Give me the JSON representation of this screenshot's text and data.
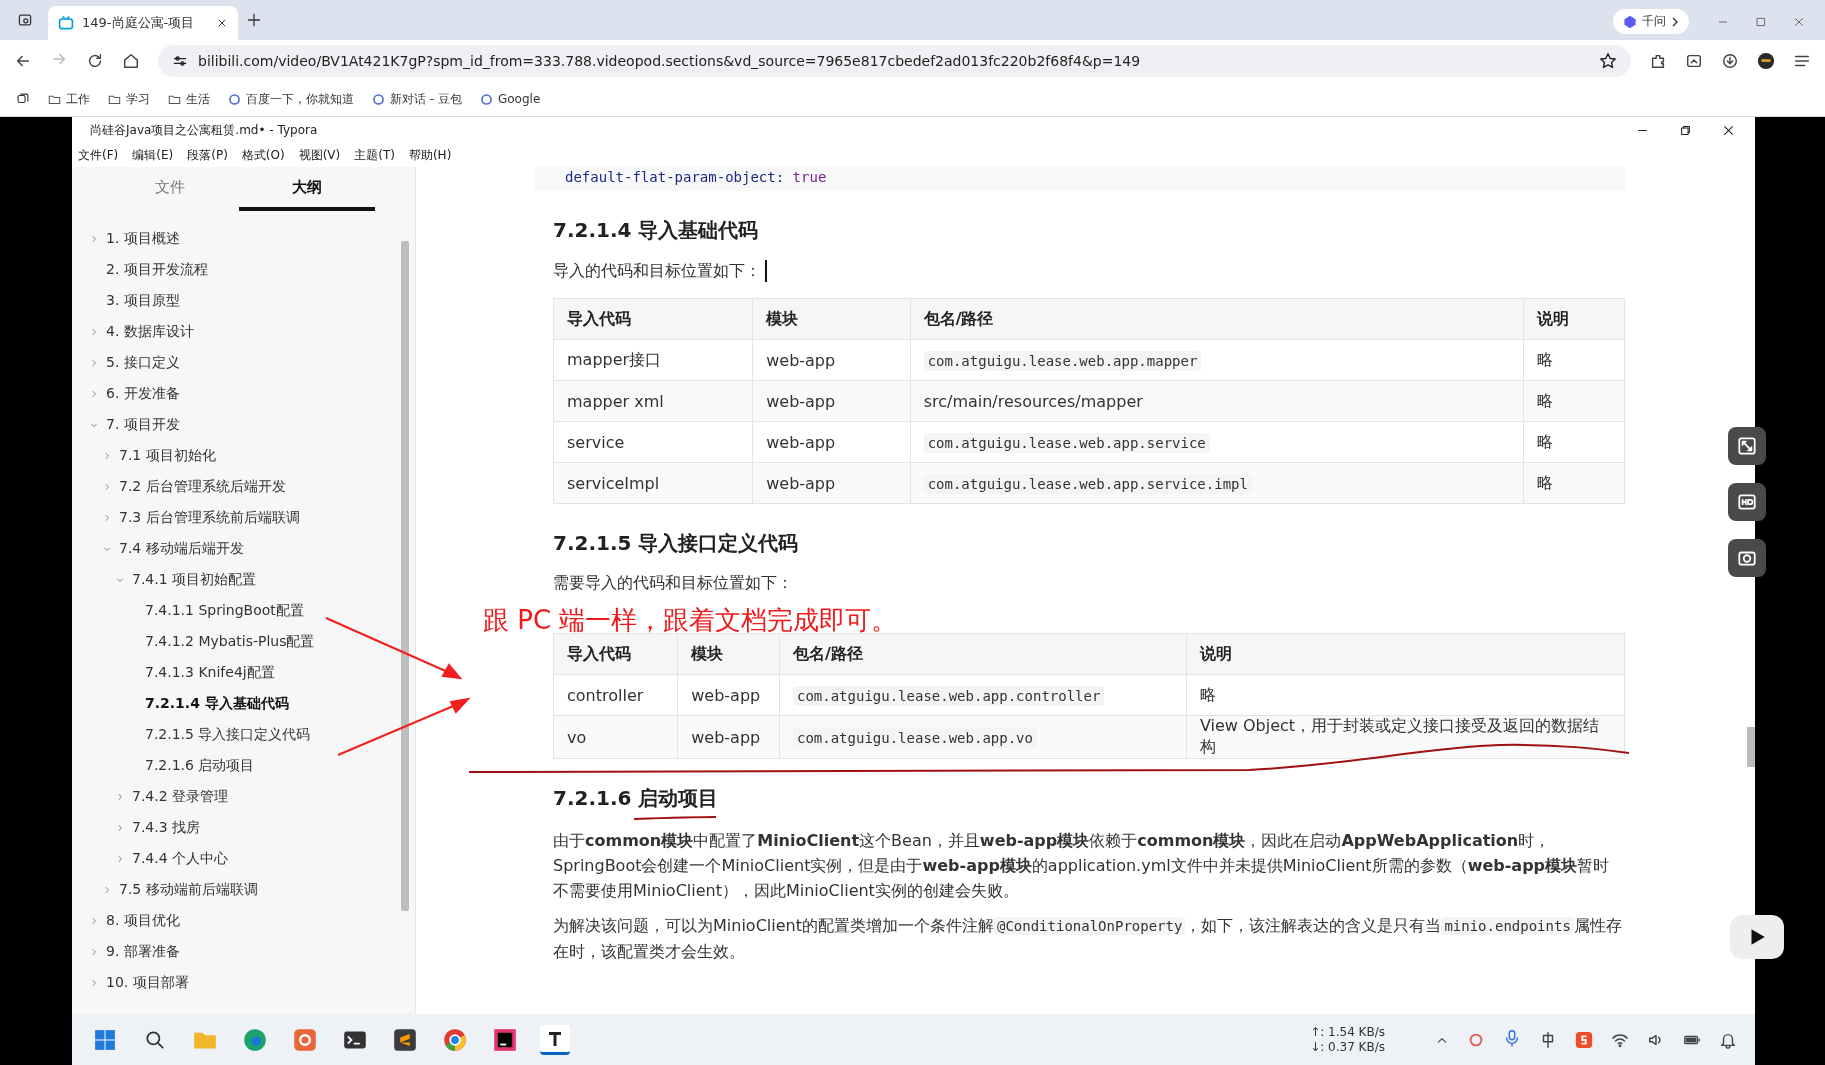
{
  "browser": {
    "tab": {
      "title": "149-尚庭公寓-项目",
      "selected": true
    },
    "assistant_button": "千问",
    "url": "bilibili.com/video/BV1At421K7gP?spm_id_from=333.788.videopod.sections&vd_source=7965e817cbedef2ad013fc220b2f68f4&p=149",
    "bookmarks": [
      {
        "label": "工作",
        "kind": "folder"
      },
      {
        "label": "学习",
        "kind": "folder"
      },
      {
        "label": "生活",
        "kind": "folder"
      },
      {
        "label": "百度一下，你就知道",
        "kind": "site"
      },
      {
        "label": "新对话 - 豆包",
        "kind": "site"
      },
      {
        "label": "Google",
        "kind": "site"
      }
    ]
  },
  "typora": {
    "title": "尚硅谷Java项目之公寓租赁.md• - Typora",
    "menu": [
      "文件(F)",
      "编辑(E)",
      "段落(P)",
      "格式(O)",
      "视图(V)",
      "主题(T)",
      "帮助(H)"
    ],
    "sidebar_tabs": [
      {
        "label": "文件",
        "selected": false
      },
      {
        "label": "大纲",
        "selected": true
      }
    ],
    "outline": [
      {
        "label": "1. 项目概述",
        "kind": "branch",
        "expanded": false,
        "selected": false
      },
      {
        "label": "2. 项目开发流程",
        "kind": "leaf",
        "selected": false
      },
      {
        "label": "3. 项目原型",
        "kind": "leaf",
        "selected": false
      },
      {
        "label": "4. 数据库设计",
        "kind": "branch",
        "expanded": false,
        "selected": false
      },
      {
        "label": "5. 接口定义",
        "kind": "branch",
        "expanded": false,
        "selected": false
      },
      {
        "label": "6. 开发准备",
        "kind": "branch",
        "expanded": false,
        "selected": false
      },
      {
        "label": "7. 项目开发",
        "kind": "branch",
        "expanded": true,
        "selected": false,
        "children": [
          {
            "label": "7.1 项目初始化",
            "kind": "branch",
            "expanded": false,
            "selected": false
          },
          {
            "label": "7.2 后台管理系统后端开发",
            "kind": "branch",
            "expanded": false,
            "selected": false
          },
          {
            "label": "7.3 后台管理系统前后端联调",
            "kind": "branch",
            "expanded": false,
            "selected": false
          },
          {
            "label": "7.4 移动端后端开发",
            "kind": "branch",
            "expanded": true,
            "selected": false,
            "children": [
              {
                "label": "7.4.1 项目初始配置",
                "kind": "branch",
                "expanded": true,
                "selected": false,
                "children": [
                  {
                    "label": "7.4.1.1 SpringBoot配置",
                    "kind": "leaf",
                    "selected": false
                  },
                  {
                    "label": "7.4.1.2 Mybatis-Plus配置",
                    "kind": "leaf",
                    "selected": false
                  },
                  {
                    "label": "7.4.1.3 Knife4j配置",
                    "kind": "leaf",
                    "selected": false
                  },
                  {
                    "label": "7.2.1.4 导入基础代码",
                    "kind": "leaf",
                    "selected": true
                  },
                  {
                    "label": "7.2.1.5 导入接口定义代码",
                    "kind": "leaf",
                    "selected": false
                  },
                  {
                    "label": "7.2.1.6 启动项目",
                    "kind": "leaf",
                    "selected": false
                  }
                ]
              },
              {
                "label": "7.4.2 登录管理",
                "kind": "branch",
                "expanded": false,
                "selected": false
              },
              {
                "label": "7.4.3 找房",
                "kind": "branch",
                "expanded": false,
                "selected": false
              },
              {
                "label": "7.4.4 个人中心",
                "kind": "branch",
                "expanded": false,
                "selected": false
              }
            ]
          },
          {
            "label": "7.5 移动端前后端联调",
            "kind": "branch",
            "expanded": false,
            "selected": false
          }
        ]
      },
      {
        "label": "8. 项目优化",
        "kind": "branch",
        "expanded": false,
        "selected": false
      },
      {
        "label": "9. 部署准备",
        "kind": "branch",
        "expanded": false,
        "selected": false
      },
      {
        "label": "10. 项目部署",
        "kind": "branch",
        "expanded": false,
        "selected": false
      }
    ]
  },
  "document": {
    "code_line": {
      "key": "default-flat-param-object:",
      "value": "true"
    },
    "sections": [
      {
        "heading": "7.2.1.4 导入基础代码",
        "intro": "导入的代码和目标位置如下：",
        "table": {
          "columns": [
            "导入代码",
            "模块",
            "包名/路径",
            "说明"
          ],
          "rows": [
            {
              "cells": [
                "mapper接口",
                "web-app",
                "com.atguigu.lease.web.app.mapper",
                "略"
              ],
              "path_is_code": true
            },
            {
              "cells": [
                "mapper xml",
                "web-app",
                "src/main/resources/mapper",
                "略"
              ],
              "path_is_code": false
            },
            {
              "cells": [
                "service",
                "web-app",
                "com.atguigu.lease.web.app.service",
                "略"
              ],
              "path_is_code": true
            },
            {
              "cells": [
                "serviceImpl",
                "web-app",
                "com.atguigu.lease.web.app.service.impl",
                "略"
              ],
              "path_is_code": true
            }
          ]
        }
      },
      {
        "heading": "7.2.1.5 导入接口定义代码",
        "intro": "需要导入的代码和目标位置如下：",
        "annotation": "跟 PC 端一样，跟着文档完成即可。",
        "table": {
          "columns": [
            "导入代码",
            "模块",
            "包名/路径",
            "说明"
          ],
          "rows": [
            {
              "cells": [
                "controller",
                "web-app",
                "com.atguigu.lease.web.app.controller",
                "略"
              ],
              "path_is_code": true
            },
            {
              "cells": [
                "vo",
                "web-app",
                "com.atguigu.lease.web.app.vo",
                "View Object，用于封装或定义接口接受及返回的数据结构"
              ],
              "path_is_code": true
            }
          ]
        }
      },
      {
        "heading": "7.2.1.6 启动项目",
        "paragraphs": [
          [
            {
              "kind": "text",
              "text": "由于**common模块**中配置了**MinioClient**这个Bean，并且**web-app模块**依赖于**common模块**，因此在启动**AppWebApplication**时，SpringBoot会创建一个MinioClient实例，但是由于**web-app模块**的application.yml文件中并未提供MinioClient所需的参数（**web-app模块**暂时不需要使用MinioClient），因此MinioClient实例的创建会失败。"
            }
          ],
          [
            {
              "kind": "text",
              "text": "为解决该问题，可以为MinioClient的配置类增加一个条件注解"
            },
            {
              "kind": "code",
              "text": "@ConditionalOnProperty"
            },
            {
              "kind": "text",
              "text": "，如下，该注解表达的含义是只有当"
            },
            {
              "kind": "code",
              "text": "minio.endpoints"
            },
            {
              "kind": "text",
              "text": "属性存在时，该配置类才会生效。"
            }
          ]
        ]
      }
    ]
  },
  "taskbar": {
    "upload": "↑: 1.54 KB/s",
    "download": "↓: 0.37 KB/s"
  }
}
